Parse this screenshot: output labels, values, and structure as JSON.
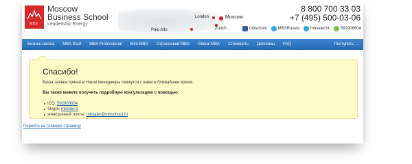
{
  "logo": {
    "mark": "MBS",
    "line1": "Moscow",
    "line2": "Business School",
    "line3": "Leadership Energy"
  },
  "map": {
    "cities": [
      "London",
      "Moscow",
      "Palo Alto",
      "Zurich"
    ]
  },
  "contacts": {
    "phone1": "8 800 700 33 03",
    "phone2": "+7 (495) 500-03-06"
  },
  "social": [
    {
      "icon": "facebook-icon",
      "label": "mbschool"
    },
    {
      "icon": "twitter-icon",
      "label": "MBSRussia"
    },
    {
      "icon": "skype-icon",
      "label": "mbsaler24"
    },
    {
      "icon": "icq-icon",
      "label": "582908604"
    }
  ],
  "nav": {
    "items": [
      "Бизнес-школа",
      "MBA Start",
      "MBA Professional",
      "Mini-MBA",
      "Отраслевой MBA",
      "Global MBA",
      "Стоимость",
      "Дипломы",
      "FAQ"
    ],
    "enroll": "Поступить →"
  },
  "notice": {
    "title": "Спасибо!",
    "text1": "Ваша заявка принята! Наши менеджеры свяжутся с вами в ближайшее время.",
    "text2": "Вы также можете получить подробную консультацию с помощью:",
    "items": [
      {
        "label": "ICQ: ",
        "value": "582908604"
      },
      {
        "label": "Skype: ",
        "value": "mbsaler1"
      },
      {
        "label": "электронной почты: ",
        "value": "mbsaler@mbschool.ru"
      }
    ]
  },
  "back_link": "Перейти на главную страницу",
  "colors": {
    "brand_red": "#d62a2a",
    "nav_blue": "#2f76c0",
    "notice_bg": "#fffbc9",
    "link": "#1d5fae"
  }
}
